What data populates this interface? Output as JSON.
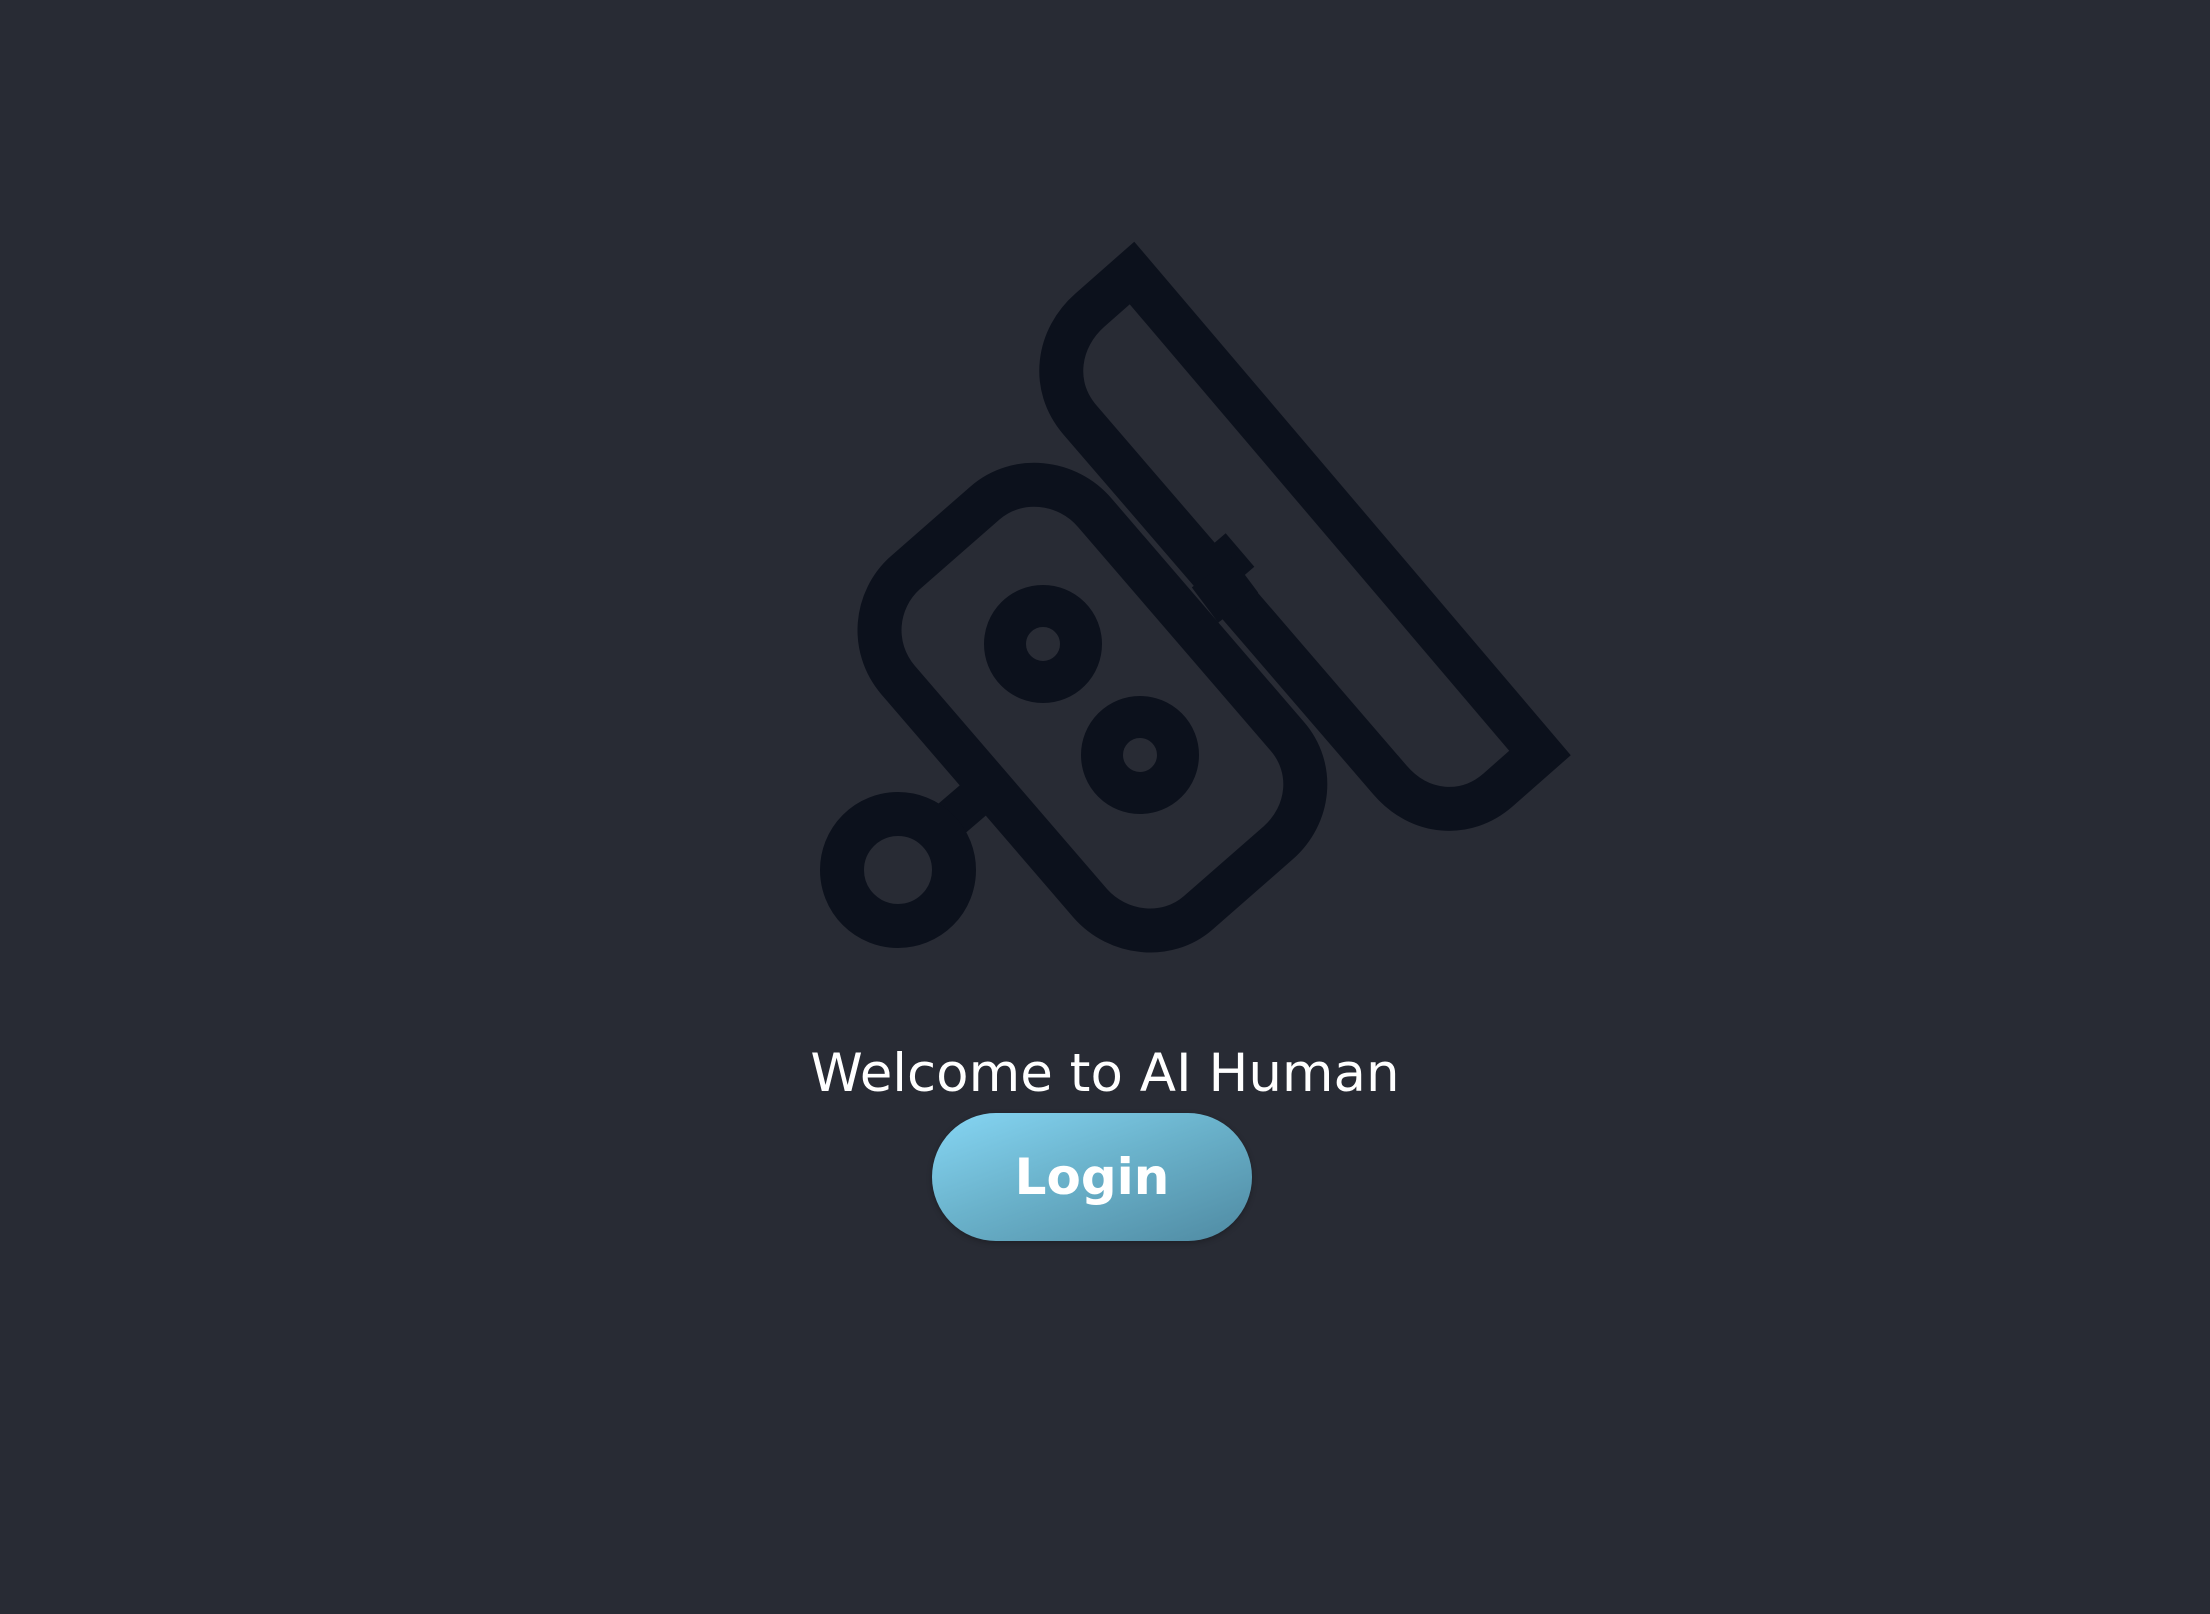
{
  "app": {
    "logo_icon": "security-camera-icon",
    "logo_color": "#0c111c",
    "background_color": "#282b34"
  },
  "welcome": {
    "text": "Welcome to AI Human"
  },
  "login": {
    "label": "Login",
    "gradient_start": "#86d6f4",
    "gradient_end": "#4f8aa2"
  }
}
